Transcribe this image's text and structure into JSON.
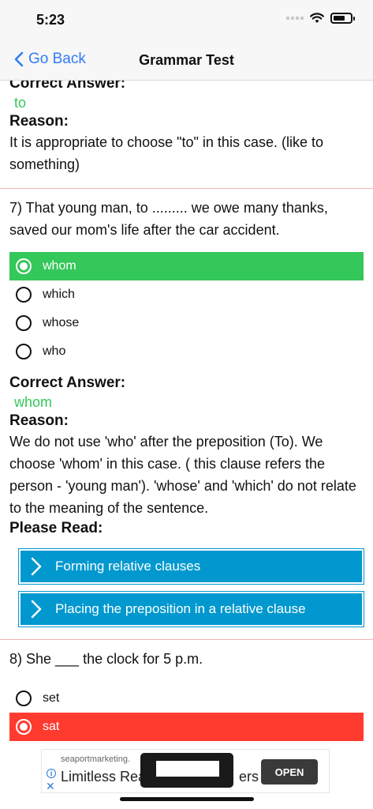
{
  "status_bar": {
    "time": "5:23"
  },
  "nav": {
    "back_label": "Go Back",
    "title": "Grammar Test"
  },
  "q6_tail": {
    "correct_label": "Correct Answer:",
    "correct_answer": "to",
    "reason_label": "Reason:",
    "reason": "It is appropriate to choose \"to\" in this case. (like to something)"
  },
  "q7": {
    "question": "7) That young man, to .........  we owe many thanks, saved our mom's life after the car accident.",
    "options": [
      {
        "label": "whom",
        "state": "correct"
      },
      {
        "label": "which",
        "state": "none"
      },
      {
        "label": "whose",
        "state": "none"
      },
      {
        "label": "who",
        "state": "none"
      }
    ],
    "correct_label": "Correct Answer:",
    "correct_answer": "whom",
    "reason_label": "Reason:",
    "reason": "We do not use 'who' after the preposition (To). We choose 'whom' in this case. ( this clause refers the person - 'young man'). 'whose' and 'which' do not relate to the meaning of the sentence.",
    "read_label": "Please Read:",
    "links": [
      "Forming relative clauses",
      "Placing the preposition in a relative clause"
    ]
  },
  "q8": {
    "question": "8) She ___ the clock for 5 p.m.",
    "options": [
      {
        "label": "set",
        "state": "none"
      },
      {
        "label": "sat",
        "state": "wrong"
      }
    ]
  },
  "ad": {
    "domain": "seaportmarketing.",
    "title": "Limitless Rea",
    "title_tail": "ers",
    "open_label": "OPEN"
  },
  "colors": {
    "accent": "#2f7cf6",
    "correct": "#34c759",
    "wrong": "#ff3b30",
    "link_button": "#0098cf"
  }
}
